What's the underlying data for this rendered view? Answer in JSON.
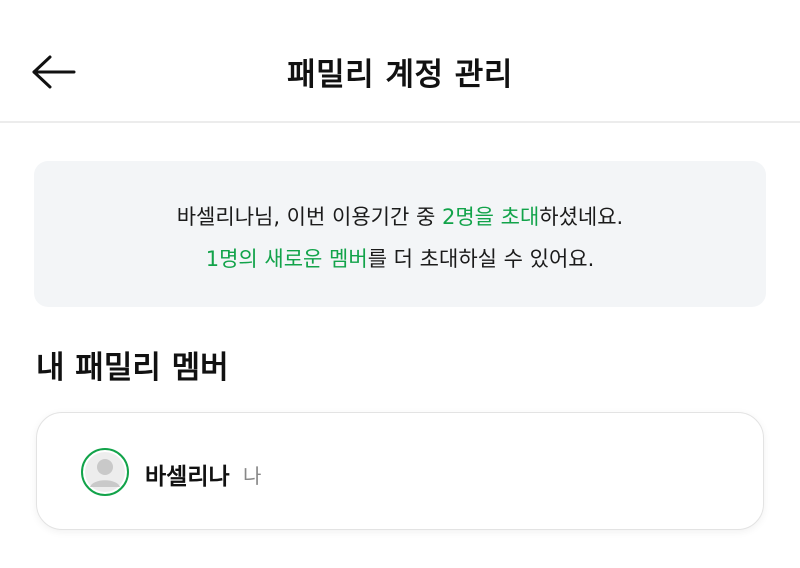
{
  "header": {
    "back_icon": "arrow-left-icon",
    "title": "패밀리 계정 관리"
  },
  "notice": {
    "line1": {
      "prefix": "바셀리나님, 이번 이용기간 중 ",
      "highlight": "2명을 초대",
      "suffix": "하셨네요."
    },
    "line2": {
      "highlight": "1명의 새로운 멤버",
      "suffix": "를 더 초대하실 수 있어요."
    },
    "accent_color": "#12a34a"
  },
  "members_section": {
    "title": "내 패밀리 멤버",
    "members": [
      {
        "name": "바셀리나",
        "tag": "나",
        "avatar_icon": "user-avatar-icon"
      }
    ]
  }
}
